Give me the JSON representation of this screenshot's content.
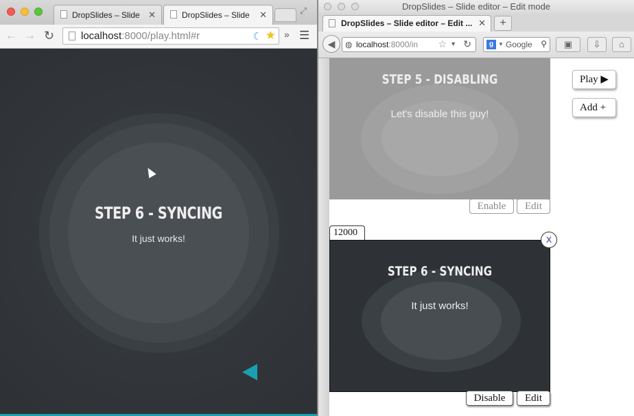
{
  "chrome": {
    "tabs": [
      {
        "title": "DropSlides – Slide e"
      },
      {
        "title": "DropSlides – Slide e"
      }
    ],
    "url_host": "localhost",
    "url_rest": ":8000/play.html#r",
    "overflow": "»"
  },
  "player": {
    "title": "STEP 6 - SYNCING",
    "subtitle": "It just works!"
  },
  "firefox": {
    "window_title": "DropSlides – Slide editor – Edit mode",
    "tab_title": "DropSlides – Slide editor – Edit ...",
    "url_host": "localhost",
    "url_rest": ":8000/in",
    "search_placeholder": "Google",
    "search_engine": "g"
  },
  "editor": {
    "play_label": "Play ▶",
    "add_label": "Add +",
    "slides": [
      {
        "title": "STEP 5 - DISABLING",
        "subtitle": "Let's disable this guy!",
        "toggle_label": "Enable",
        "edit_label": "Edit"
      },
      {
        "duration": "12000",
        "remove_label": "X",
        "title": "STEP 6 - SYNCING",
        "subtitle": "It just works!",
        "toggle_label": "Disable",
        "edit_label": "Edit"
      }
    ]
  },
  "colors": {
    "accent": "#1aa0b0",
    "player_bg": "#2e3236",
    "disabled_slide_bg": "#9a9a9a"
  }
}
